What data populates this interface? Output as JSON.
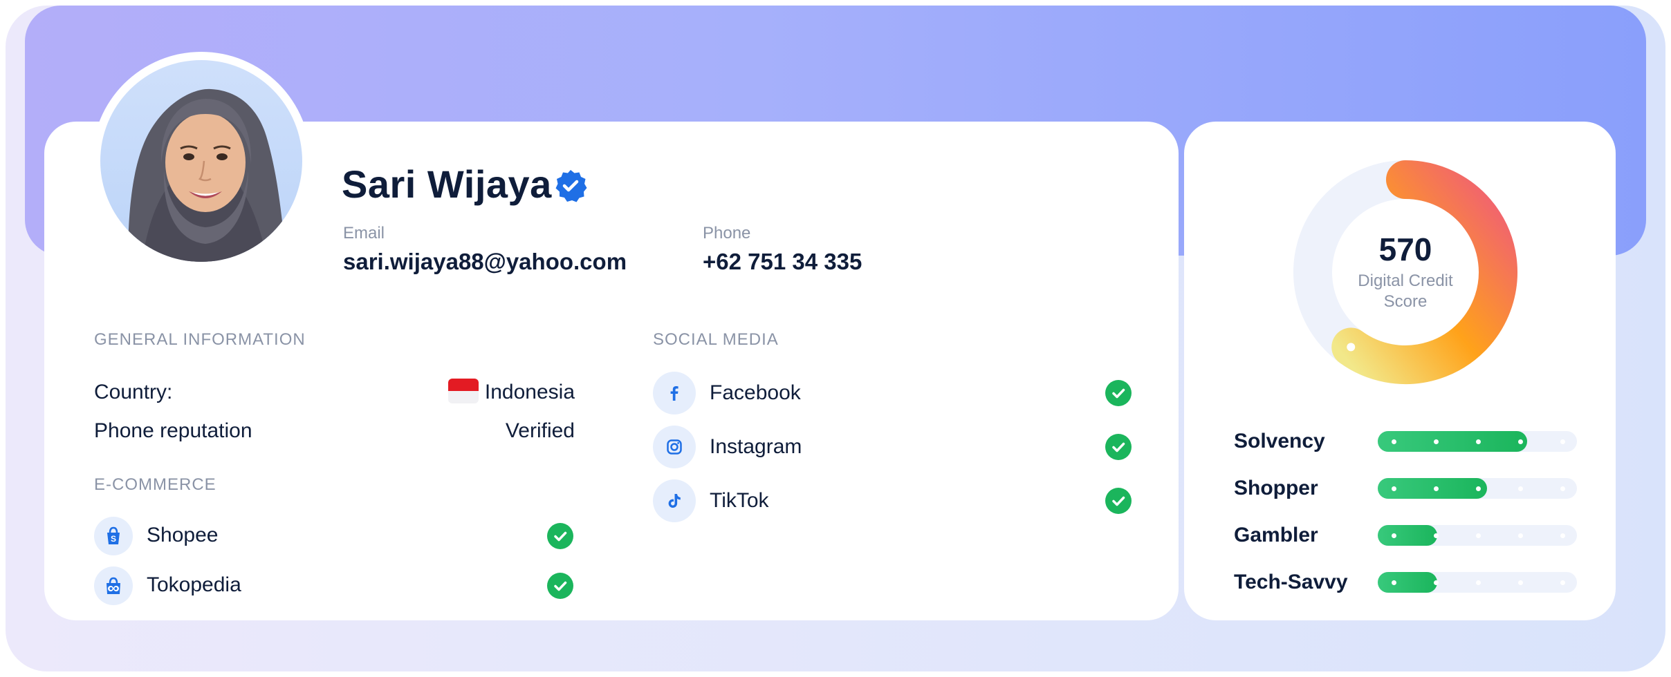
{
  "profile": {
    "name": "Sari Wijaya",
    "email_label": "Email",
    "email": "sari.wijaya88@yahoo.com",
    "phone_label": "Phone",
    "phone": "+62 751 34 335"
  },
  "general_information": {
    "title": "GENERAL INFORMATION",
    "rows": [
      {
        "label": "Country:",
        "value": "Indonesia",
        "flag": "indonesia-flag"
      },
      {
        "label": "Phone reputation",
        "value": "Verified"
      }
    ]
  },
  "ecommerce": {
    "title": "E-COMMERCE",
    "items": [
      {
        "label": "Shopee",
        "icon": "shopee-icon",
        "status": "check"
      },
      {
        "label": "Tokopedia",
        "icon": "tokopedia-icon",
        "status": "check"
      }
    ]
  },
  "social_media": {
    "title": "SOCIAL MEDIA",
    "items": [
      {
        "label": "Facebook",
        "icon": "facebook-icon",
        "status": "check"
      },
      {
        "label": "Instagram",
        "icon": "instagram-icon",
        "status": "check"
      },
      {
        "label": "TikTok",
        "icon": "tiktok-icon",
        "status": "check"
      }
    ]
  },
  "credit_score": {
    "value": "570",
    "label_line1": "Digital Credit",
    "label_line2": "Score",
    "gauge_fraction": 0.6
  },
  "traits": [
    {
      "label": "Solvency",
      "level": 0.75
    },
    {
      "label": "Shopper",
      "level": 0.55
    },
    {
      "label": "Gambler",
      "level": 0.3
    },
    {
      "label": "Tech-Savvy",
      "level": 0.3
    }
  ],
  "colors": {
    "accent": "#1f6fe5",
    "success": "#1bb55c",
    "banner_start": "#b3aef9",
    "banner_end": "#8a9ffb",
    "gauge_start": "#f2e88a",
    "gauge_mid": "#ffa21a",
    "gauge_end": "#ef5b7a"
  }
}
